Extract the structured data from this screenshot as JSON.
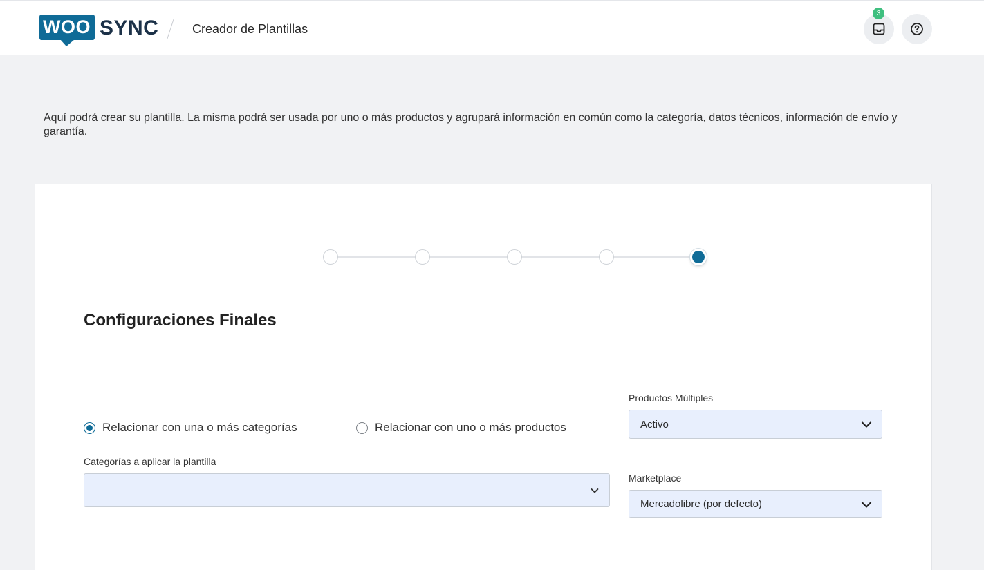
{
  "header": {
    "logo_woo": "WOO",
    "logo_sync": "SYNC",
    "page_title": "Creador de Plantillas",
    "notification_count": "3"
  },
  "intro_text": "Aquí podrá crear su plantilla. La misma podrá ser usada por uno o más productos y agrupará información en común como la categoría, datos técnicos, información de envío y garantía.",
  "stepper": {
    "total_steps": 5,
    "current_step": 5,
    "accent_color": "#0f6b97"
  },
  "section_title": "Configuraciones Finales",
  "relation": {
    "option_categories": "Relacionar con una o más categorías",
    "option_products": "Relacionar con uno o más productos",
    "selected": "categories"
  },
  "categories_field": {
    "label": "Categorías a aplicar la plantilla",
    "value": ""
  },
  "multiple_products": {
    "label": "Productos Múltiples",
    "value": "Activo"
  },
  "marketplace": {
    "label": "Marketplace",
    "value": "Mercadolibre (por defecto)"
  },
  "icons": {
    "inbox": "inbox-icon",
    "help": "help-icon",
    "chevron": "chevron-down-icon"
  }
}
